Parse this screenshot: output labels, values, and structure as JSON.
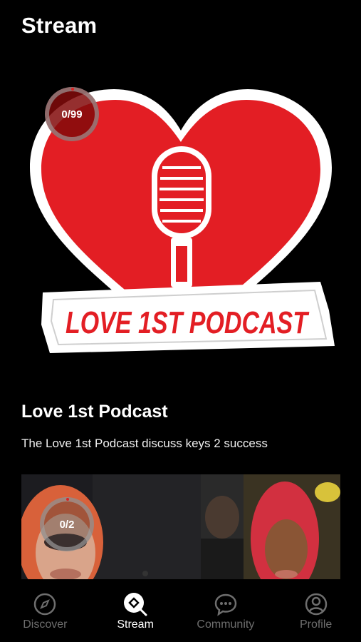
{
  "header": {
    "title": "Stream"
  },
  "featured": {
    "progress": "0/99",
    "art_text": "LOVE 1ST PODCAST",
    "title": "Love 1st Podcast",
    "description": "The Love 1st Podcast discuss keys 2 success"
  },
  "second": {
    "progress": "0/2"
  },
  "tabs": [
    {
      "label": "Discover",
      "icon": "compass-icon"
    },
    {
      "label": "Stream",
      "icon": "stream-search-icon"
    },
    {
      "label": "Community",
      "icon": "chat-bubble-icon"
    },
    {
      "label": "Profile",
      "icon": "user-icon"
    }
  ],
  "colors": {
    "accent": "#e31e24",
    "inactive": "#6e6e6e"
  }
}
